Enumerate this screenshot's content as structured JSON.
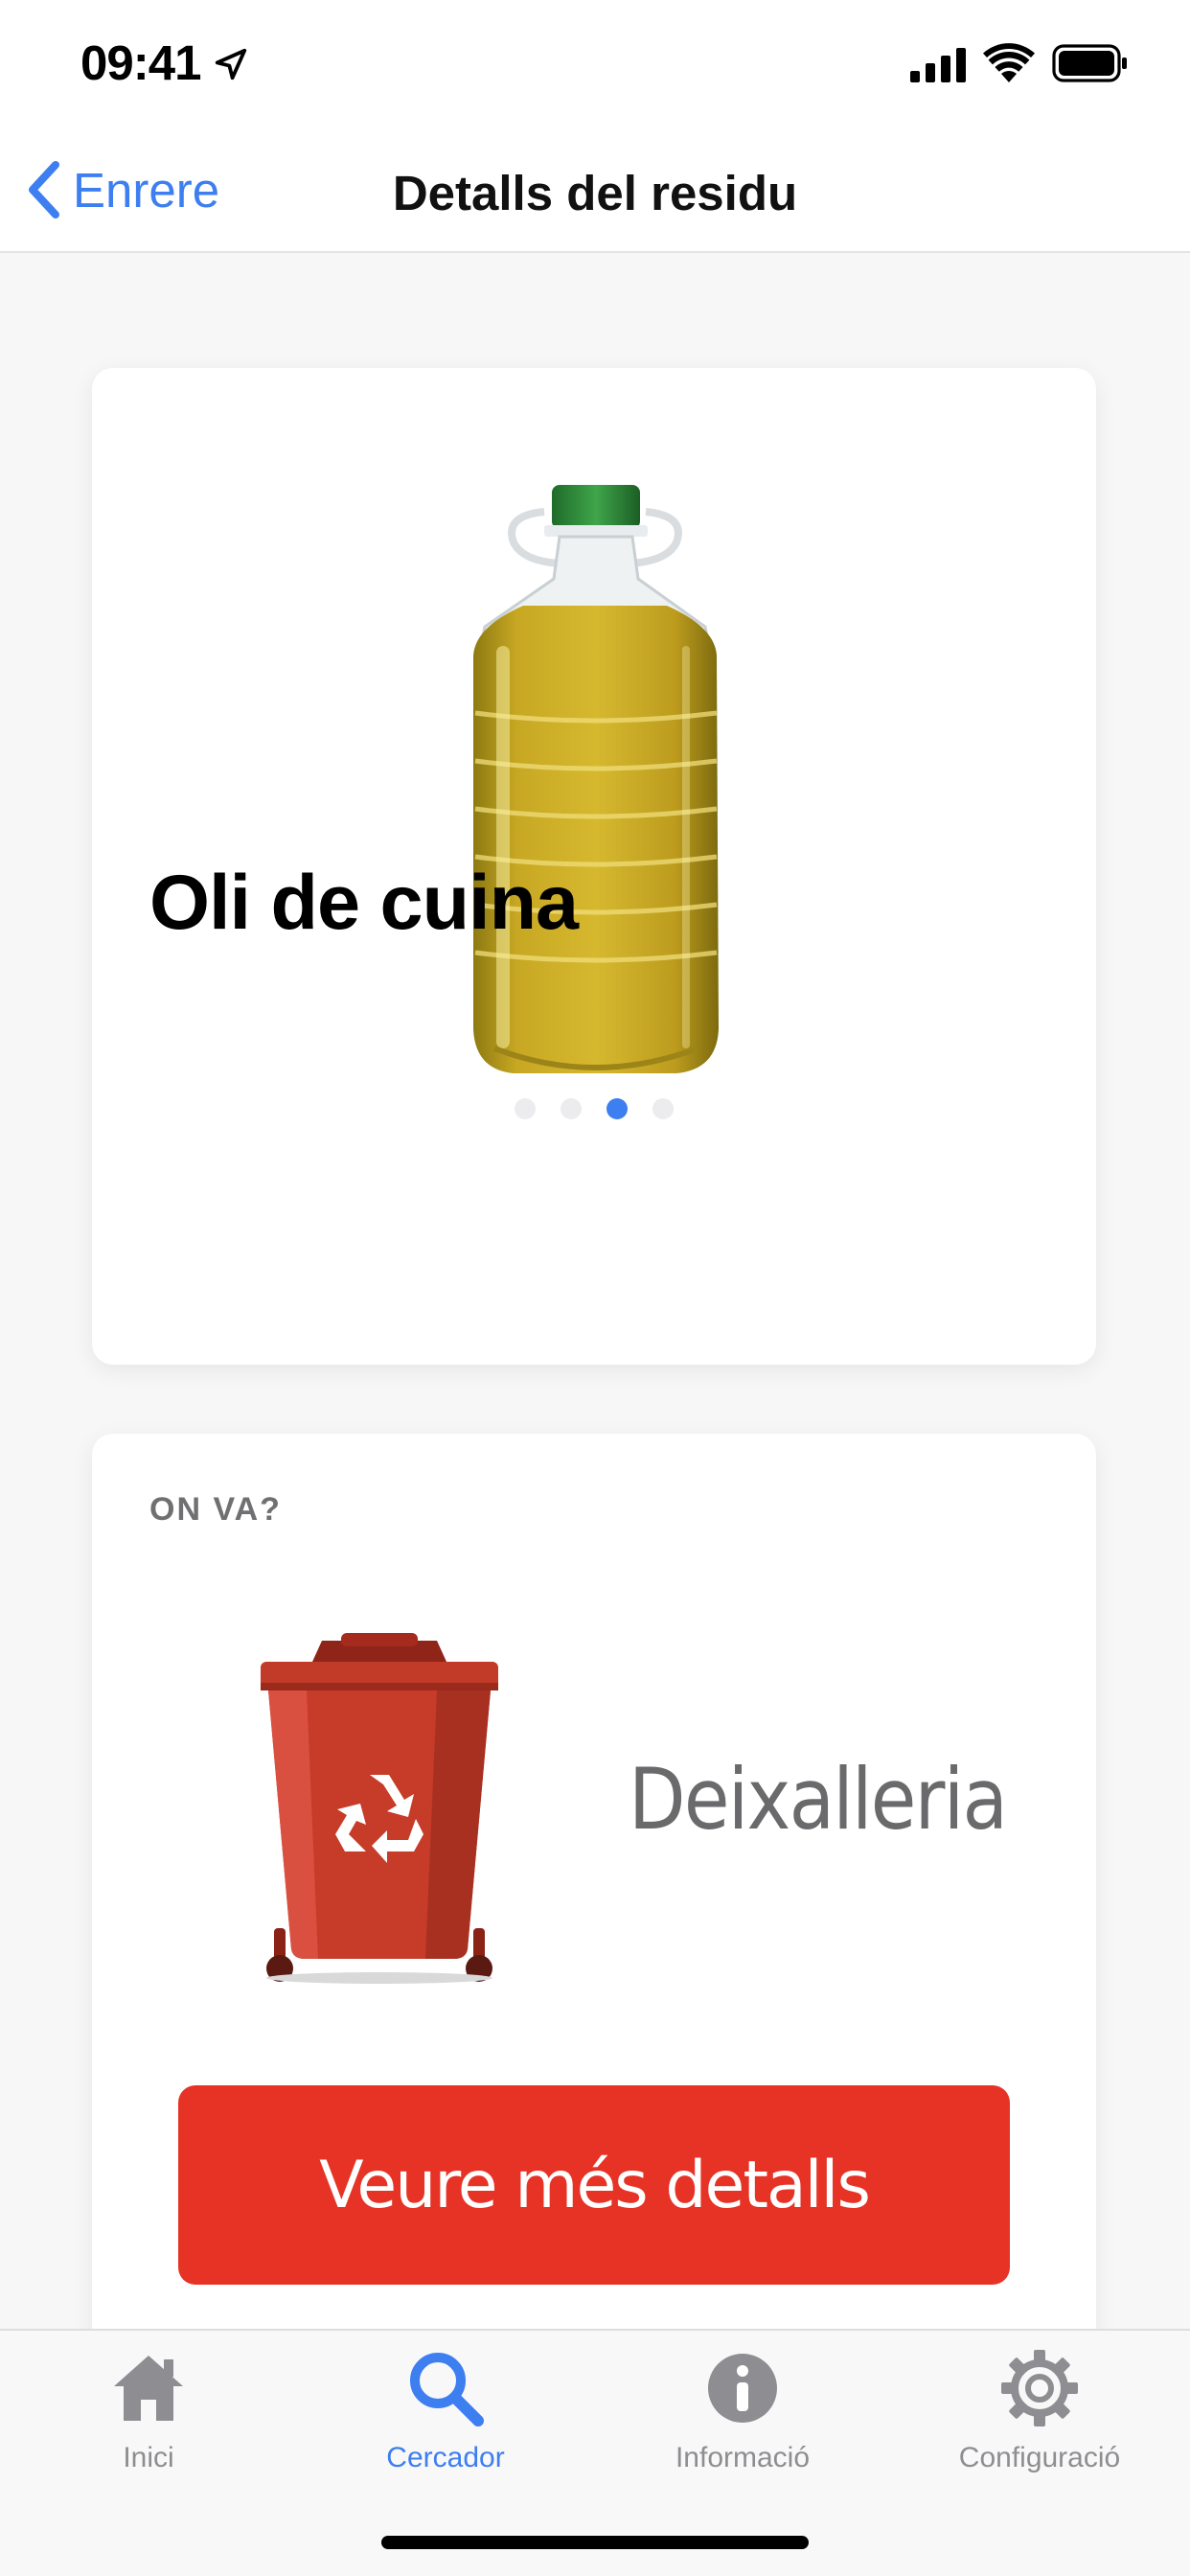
{
  "status_bar": {
    "time": "09:41",
    "icons": [
      "location-arrow-icon",
      "cellular-signal-icon",
      "wifi-icon",
      "battery-icon"
    ]
  },
  "nav": {
    "back_label": "Enrere",
    "title": "Detalls del residu"
  },
  "item": {
    "name": "Oli de cuina",
    "image": "olive-oil-bottle",
    "carousel": {
      "total": 4,
      "active_index": 2
    }
  },
  "destination": {
    "section_label": "ON VA?",
    "name": "Deixalleria",
    "bin_image": "red-recycling-bin",
    "button_label": "Veure més detalls"
  },
  "tab_bar": {
    "tabs": [
      {
        "label": "Inici",
        "icon": "home-icon",
        "active": false
      },
      {
        "label": "Cercador",
        "icon": "search-icon",
        "active": true
      },
      {
        "label": "Informació",
        "icon": "info-icon",
        "active": false
      },
      {
        "label": "Configuració",
        "icon": "gear-icon",
        "active": false
      }
    ]
  },
  "colors": {
    "accent": "#3d7ef1",
    "primary_button": "#e63326",
    "inactive_tab": "#8e8e92"
  }
}
